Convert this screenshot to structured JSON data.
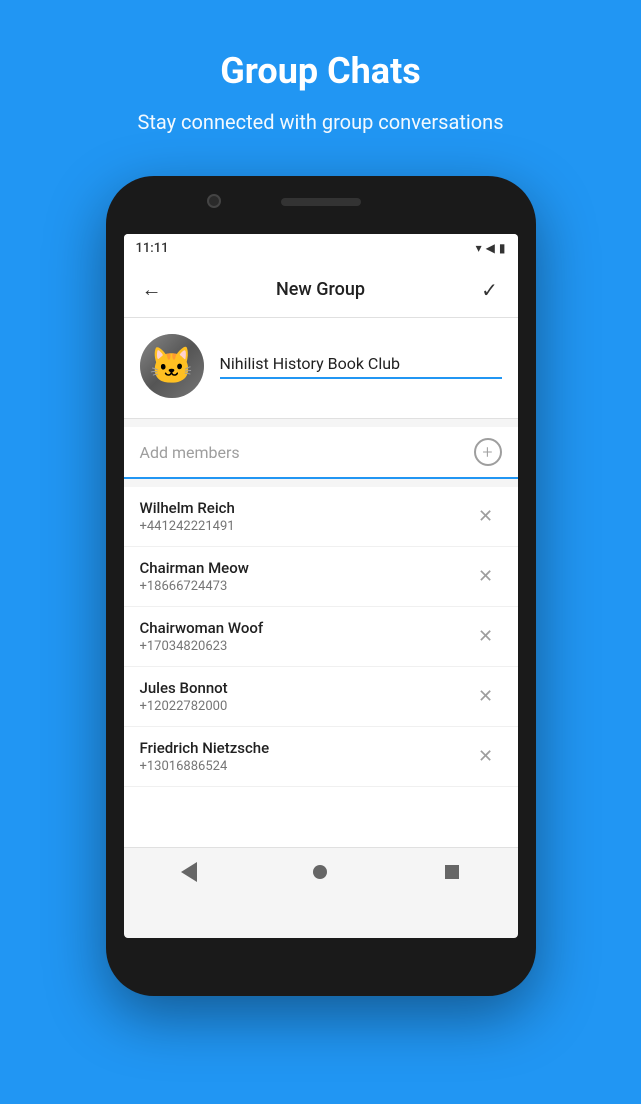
{
  "page": {
    "background_color": "#2196F3",
    "title": "Group Chats",
    "subtitle": "Stay connected with group conversations"
  },
  "status_bar": {
    "time": "11:11",
    "icons": "▾◀▮"
  },
  "nav": {
    "title": "New Group",
    "back_label": "←",
    "check_label": "✓"
  },
  "group": {
    "name": "Nihilist History Book Club",
    "avatar_emoji": "🐱"
  },
  "add_members": {
    "placeholder": "Add members",
    "add_icon_label": "+"
  },
  "members": [
    {
      "name": "Wilhelm Reich",
      "phone": "+441242221491"
    },
    {
      "name": "Chairman Meow",
      "phone": "+18666724473"
    },
    {
      "name": "Chairwoman Woof",
      "phone": "+17034820623"
    },
    {
      "name": "Jules Bonnot",
      "phone": "+12022782000"
    },
    {
      "name": "Friedrich Nietzsche",
      "phone": "+13016886524"
    }
  ],
  "bottom_nav": {
    "back_label": "◀",
    "home_label": "●",
    "recent_label": "■"
  }
}
